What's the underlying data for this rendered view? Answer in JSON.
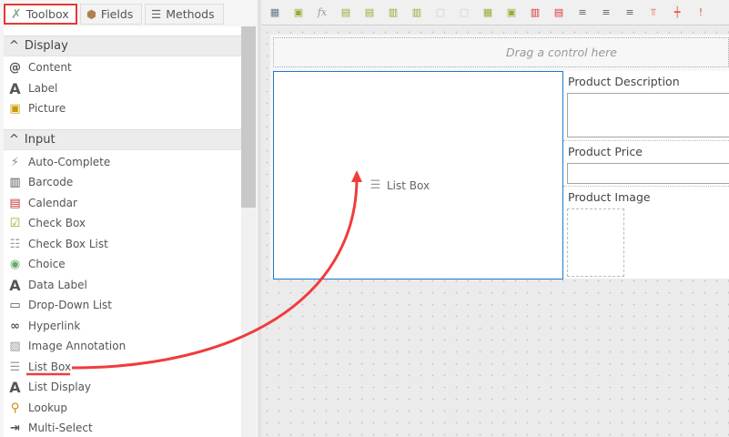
{
  "tabs": [
    {
      "label": "Toolbox",
      "icon": "wrench-icon"
    },
    {
      "label": "Fields",
      "icon": "hexagon-icon"
    },
    {
      "label": "Methods",
      "icon": "methods-icon"
    }
  ],
  "sections": [
    {
      "label": "Display",
      "items": [
        {
          "label": "Content",
          "icon": "at-icon"
        },
        {
          "label": "Label",
          "icon": "letter-a-icon"
        },
        {
          "label": "Picture",
          "icon": "picture-icon"
        }
      ]
    },
    {
      "label": "Input",
      "items": [
        {
          "label": "Auto-Complete",
          "icon": "lightning-icon"
        },
        {
          "label": "Barcode",
          "icon": "barcode-icon"
        },
        {
          "label": "Calendar",
          "icon": "calendar-icon"
        },
        {
          "label": "Check Box",
          "icon": "checkbox-icon"
        },
        {
          "label": "Check Box List",
          "icon": "checkbox-list-icon"
        },
        {
          "label": "Choice",
          "icon": "choice-icon"
        },
        {
          "label": "Data Label",
          "icon": "data-label-icon"
        },
        {
          "label": "Drop-Down List",
          "icon": "dropdown-icon"
        },
        {
          "label": "Hyperlink",
          "icon": "link-icon"
        },
        {
          "label": "Image Annotation",
          "icon": "image-annotation-icon"
        },
        {
          "label": "List Box",
          "icon": "list-box-icon"
        },
        {
          "label": "List Display",
          "icon": "list-display-icon"
        },
        {
          "label": "Lookup",
          "icon": "magnifier-icon"
        },
        {
          "label": "Multi-Select",
          "icon": "multi-select-icon"
        }
      ]
    }
  ],
  "canvas": {
    "drag_placeholder": "Drag a control here",
    "list_box_label": "List Box",
    "fields": [
      {
        "label": "Product Description"
      },
      {
        "label": "Product Price"
      },
      {
        "label": "Product Image"
      }
    ]
  },
  "colors": {
    "accent_red": "#e53935",
    "selection_blue": "#1a7ad0"
  }
}
